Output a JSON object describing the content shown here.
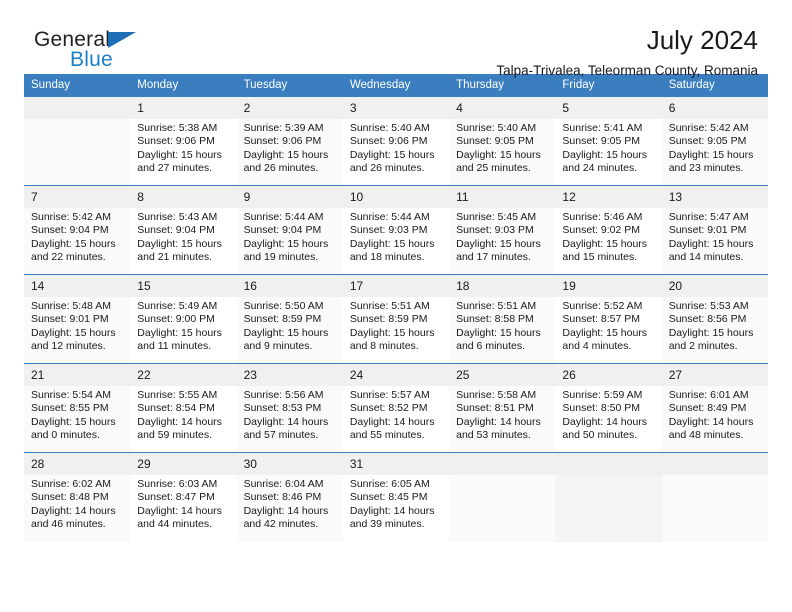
{
  "brand": {
    "name_part1": "General",
    "name_part2": "Blue",
    "triangle_color": "#1f6fb6",
    "blue_color": "#1f7fc4"
  },
  "header": {
    "title": "July 2024",
    "subtitle": "Talpa-Trivalea, Teleorman County, Romania"
  },
  "theme": {
    "header_bg": "#3a7ebf",
    "header_text": "#ffffff",
    "daynum_bg": "#f0f0f0",
    "row_border": "#3a7ebf"
  },
  "weekdays": [
    "Sunday",
    "Monday",
    "Tuesday",
    "Wednesday",
    "Thursday",
    "Friday",
    "Saturday"
  ],
  "weeks": [
    [
      {
        "day": "",
        "sunrise": "",
        "sunset": "",
        "daylight": "",
        "empty": true
      },
      {
        "day": "1",
        "sunrise": "Sunrise: 5:38 AM",
        "sunset": "Sunset: 9:06 PM",
        "daylight": "Daylight: 15 hours and 27 minutes."
      },
      {
        "day": "2",
        "sunrise": "Sunrise: 5:39 AM",
        "sunset": "Sunset: 9:06 PM",
        "daylight": "Daylight: 15 hours and 26 minutes."
      },
      {
        "day": "3",
        "sunrise": "Sunrise: 5:40 AM",
        "sunset": "Sunset: 9:06 PM",
        "daylight": "Daylight: 15 hours and 26 minutes."
      },
      {
        "day": "4",
        "sunrise": "Sunrise: 5:40 AM",
        "sunset": "Sunset: 9:05 PM",
        "daylight": "Daylight: 15 hours and 25 minutes."
      },
      {
        "day": "5",
        "sunrise": "Sunrise: 5:41 AM",
        "sunset": "Sunset: 9:05 PM",
        "daylight": "Daylight: 15 hours and 24 minutes."
      },
      {
        "day": "6",
        "sunrise": "Sunrise: 5:42 AM",
        "sunset": "Sunset: 9:05 PM",
        "daylight": "Daylight: 15 hours and 23 minutes."
      }
    ],
    [
      {
        "day": "7",
        "sunrise": "Sunrise: 5:42 AM",
        "sunset": "Sunset: 9:04 PM",
        "daylight": "Daylight: 15 hours and 22 minutes."
      },
      {
        "day": "8",
        "sunrise": "Sunrise: 5:43 AM",
        "sunset": "Sunset: 9:04 PM",
        "daylight": "Daylight: 15 hours and 21 minutes."
      },
      {
        "day": "9",
        "sunrise": "Sunrise: 5:44 AM",
        "sunset": "Sunset: 9:04 PM",
        "daylight": "Daylight: 15 hours and 19 minutes."
      },
      {
        "day": "10",
        "sunrise": "Sunrise: 5:44 AM",
        "sunset": "Sunset: 9:03 PM",
        "daylight": "Daylight: 15 hours and 18 minutes."
      },
      {
        "day": "11",
        "sunrise": "Sunrise: 5:45 AM",
        "sunset": "Sunset: 9:03 PM",
        "daylight": "Daylight: 15 hours and 17 minutes."
      },
      {
        "day": "12",
        "sunrise": "Sunrise: 5:46 AM",
        "sunset": "Sunset: 9:02 PM",
        "daylight": "Daylight: 15 hours and 15 minutes."
      },
      {
        "day": "13",
        "sunrise": "Sunrise: 5:47 AM",
        "sunset": "Sunset: 9:01 PM",
        "daylight": "Daylight: 15 hours and 14 minutes."
      }
    ],
    [
      {
        "day": "14",
        "sunrise": "Sunrise: 5:48 AM",
        "sunset": "Sunset: 9:01 PM",
        "daylight": "Daylight: 15 hours and 12 minutes."
      },
      {
        "day": "15",
        "sunrise": "Sunrise: 5:49 AM",
        "sunset": "Sunset: 9:00 PM",
        "daylight": "Daylight: 15 hours and 11 minutes."
      },
      {
        "day": "16",
        "sunrise": "Sunrise: 5:50 AM",
        "sunset": "Sunset: 8:59 PM",
        "daylight": "Daylight: 15 hours and 9 minutes."
      },
      {
        "day": "17",
        "sunrise": "Sunrise: 5:51 AM",
        "sunset": "Sunset: 8:59 PM",
        "daylight": "Daylight: 15 hours and 8 minutes."
      },
      {
        "day": "18",
        "sunrise": "Sunrise: 5:51 AM",
        "sunset": "Sunset: 8:58 PM",
        "daylight": "Daylight: 15 hours and 6 minutes."
      },
      {
        "day": "19",
        "sunrise": "Sunrise: 5:52 AM",
        "sunset": "Sunset: 8:57 PM",
        "daylight": "Daylight: 15 hours and 4 minutes."
      },
      {
        "day": "20",
        "sunrise": "Sunrise: 5:53 AM",
        "sunset": "Sunset: 8:56 PM",
        "daylight": "Daylight: 15 hours and 2 minutes."
      }
    ],
    [
      {
        "day": "21",
        "sunrise": "Sunrise: 5:54 AM",
        "sunset": "Sunset: 8:55 PM",
        "daylight": "Daylight: 15 hours and 0 minutes."
      },
      {
        "day": "22",
        "sunrise": "Sunrise: 5:55 AM",
        "sunset": "Sunset: 8:54 PM",
        "daylight": "Daylight: 14 hours and 59 minutes."
      },
      {
        "day": "23",
        "sunrise": "Sunrise: 5:56 AM",
        "sunset": "Sunset: 8:53 PM",
        "daylight": "Daylight: 14 hours and 57 minutes."
      },
      {
        "day": "24",
        "sunrise": "Sunrise: 5:57 AM",
        "sunset": "Sunset: 8:52 PM",
        "daylight": "Daylight: 14 hours and 55 minutes."
      },
      {
        "day": "25",
        "sunrise": "Sunrise: 5:58 AM",
        "sunset": "Sunset: 8:51 PM",
        "daylight": "Daylight: 14 hours and 53 minutes."
      },
      {
        "day": "26",
        "sunrise": "Sunrise: 5:59 AM",
        "sunset": "Sunset: 8:50 PM",
        "daylight": "Daylight: 14 hours and 50 minutes."
      },
      {
        "day": "27",
        "sunrise": "Sunrise: 6:01 AM",
        "sunset": "Sunset: 8:49 PM",
        "daylight": "Daylight: 14 hours and 48 minutes."
      }
    ],
    [
      {
        "day": "28",
        "sunrise": "Sunrise: 6:02 AM",
        "sunset": "Sunset: 8:48 PM",
        "daylight": "Daylight: 14 hours and 46 minutes."
      },
      {
        "day": "29",
        "sunrise": "Sunrise: 6:03 AM",
        "sunset": "Sunset: 8:47 PM",
        "daylight": "Daylight: 14 hours and 44 minutes."
      },
      {
        "day": "30",
        "sunrise": "Sunrise: 6:04 AM",
        "sunset": "Sunset: 8:46 PM",
        "daylight": "Daylight: 14 hours and 42 minutes."
      },
      {
        "day": "31",
        "sunrise": "Sunrise: 6:05 AM",
        "sunset": "Sunset: 8:45 PM",
        "daylight": "Daylight: 14 hours and 39 minutes."
      },
      {
        "day": "",
        "sunrise": "",
        "sunset": "",
        "daylight": "",
        "empty": true
      },
      {
        "day": "",
        "sunrise": "",
        "sunset": "",
        "daylight": "",
        "empty": true
      },
      {
        "day": "",
        "sunrise": "",
        "sunset": "",
        "daylight": "",
        "empty": true
      }
    ]
  ]
}
